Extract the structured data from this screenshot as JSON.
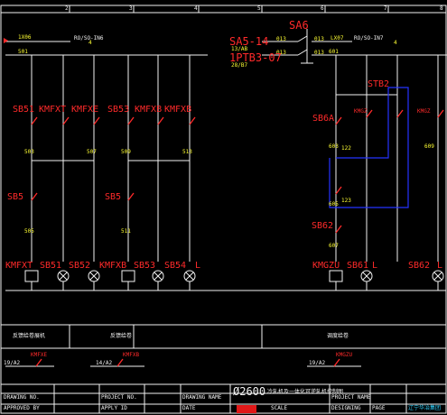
{
  "grid_numbers": [
    "2",
    "3",
    "4",
    "5",
    "6",
    "7",
    "8"
  ],
  "top_left": {
    "ref_1x06": "1X06",
    "ro_so_in6": "RO/SO-IN6",
    "ro_so_in6_suffix": "4",
    "wire_501": "501"
  },
  "top_right": {
    "sa6": "SA6",
    "sa5_14": "SA5-14",
    "sa5_sub": "13/AB",
    "n013a": "013",
    "n013b": "013",
    "n013c": "013",
    "n013d": "013",
    "ptb3": "1PTB3-07",
    "ptb3_sub": "28/B7",
    "lx07": "LX07",
    "ro_so_in7": "RO/SO-IN7",
    "ro_so_in7_suffix": "4",
    "wire_601": "601"
  },
  "sections": {
    "left_header": "反馈给卷展机",
    "mid_header": "反馈给卷",
    "right_header": "调度给卷"
  },
  "devices": {
    "sb51": "SB51",
    "kmfxt_top": "KMFXT",
    "kmfxe": "KMFXE",
    "sb53": "SB53",
    "kmfxb_top": "KMFXB",
    "kmfxb2_top": "KMFXB",
    "sb5_a": "SB5",
    "sb5_b": "SB5",
    "sb6a": "SB6A",
    "kmgz_top": "KMGZ",
    "stb2": "STB2",
    "kmgz_right": "KMGZ",
    "sb62": "SB62"
  },
  "bottom_devices": [
    "KMFXT",
    "SB51",
    "SB52",
    "KMFXB",
    "SB53",
    "SB54",
    "KMGZU",
    "SB61",
    "SB62"
  ],
  "bottom_lamps": [
    "L",
    "L",
    "L",
    "L",
    "L"
  ],
  "wires": {
    "w503": "503",
    "w507": "507",
    "w509": "509",
    "w513": "513",
    "w505": "505",
    "w511": "511",
    "w603": "603",
    "w605": "605",
    "w607": "607",
    "w609": "609",
    "w122": "122",
    "w123": "123"
  },
  "bottom_refs": {
    "ref_19a2": "19/A2",
    "kmfxe_ref": "KMFXE",
    "ref_14a2": "14/A2",
    "kmfxb_ref": "KMFXB",
    "ref_19a2b": "19/A2",
    "kmgz_ref": "KMGZU"
  },
  "title_block": {
    "drawing_no": "DRAWING NO.",
    "project_no": "PROJECT NO.",
    "drawing_name": "DRAWING NAME",
    "project_name": "PROJECT NAME",
    "title": "Ø2600",
    "title_cn": "冷轧机及一体化可逆轧机控制图",
    "page": "PAGE",
    "scale": "SCALE",
    "designing": "DESIGNING",
    "approved_by": "APPROVED BY",
    "apply_id": "APPLY ID",
    "date": "DATE",
    "company": "辽宁华冶集团"
  }
}
